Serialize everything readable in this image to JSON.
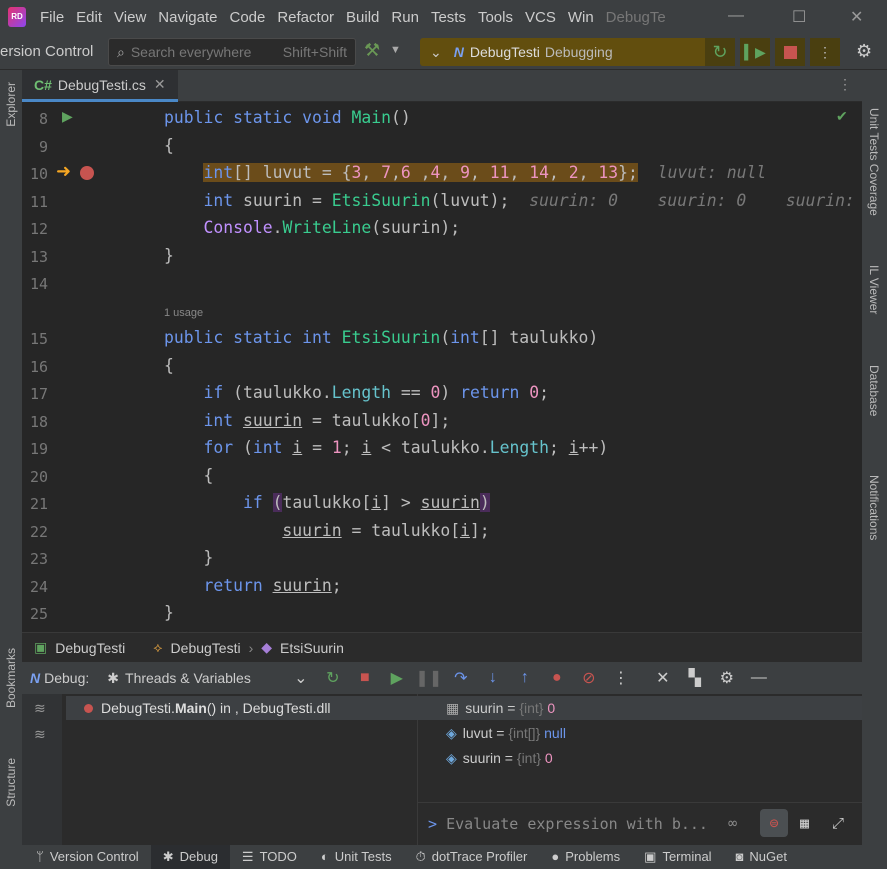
{
  "menu": [
    "File",
    "Edit",
    "View",
    "Navigate",
    "Code",
    "Refactor",
    "Build",
    "Run",
    "Tests",
    "Tools",
    "VCS",
    "Win"
  ],
  "window_title": "DebugTe",
  "toolbar": {
    "vcs_label": "ersion Control",
    "search_placeholder": "Search everywhere",
    "search_shortcut": "Shift+Shift",
    "run_config": "DebugTesti",
    "run_state": "Debugging"
  },
  "tab": {
    "lang": "C#",
    "label": "DebugTesti.cs"
  },
  "left_tools": [
    "Explorer",
    "Bookmarks",
    "Structure"
  ],
  "right_tools": [
    "Unit Tests Coverage",
    "IL Viewer",
    "Database",
    "Notifications"
  ],
  "editor": {
    "usage_hint": "1 usage",
    "lines": [
      {
        "n": "8",
        "t": [
          [
            "public static void ",
            "kw"
          ],
          [
            "Main",
            "fn"
          ],
          [
            "()",
            ""
          ]
        ]
      },
      {
        "n": "9",
        "t": [
          [
            "{",
            ""
          ]
        ]
      },
      {
        "n": "10",
        "hl": true,
        "t": [
          [
            "    ",
            ""
          ],
          [
            "int",
            "kw hl"
          ],
          [
            "[] luvut = {",
            "hl"
          ],
          [
            "3",
            "num hl"
          ],
          [
            ", ",
            "hl"
          ],
          [
            "7",
            "num hl"
          ],
          [
            ",",
            "hl"
          ],
          [
            "6",
            "num hl"
          ],
          [
            " ,",
            "hl"
          ],
          [
            "4",
            "num hl"
          ],
          [
            ", ",
            "hl"
          ],
          [
            "9",
            "num hl"
          ],
          [
            ", ",
            "hl"
          ],
          [
            "11",
            "num hl"
          ],
          [
            ", ",
            "hl"
          ],
          [
            "14",
            "num hl"
          ],
          [
            ", ",
            "hl"
          ],
          [
            "2",
            "num hl"
          ],
          [
            ", ",
            "hl"
          ],
          [
            "13",
            "num hl"
          ],
          [
            "};",
            "hl"
          ],
          [
            "  luvut: null",
            "hint"
          ]
        ]
      },
      {
        "n": "11",
        "t": [
          [
            "    ",
            ""
          ],
          [
            "int",
            "kw"
          ],
          [
            " suurin = ",
            ""
          ],
          [
            "EtsiSuurin",
            "fn"
          ],
          [
            "(luvut);",
            ""
          ],
          [
            "  suurin: 0    suurin: 0    suurin:",
            "hint"
          ]
        ]
      },
      {
        "n": "12",
        "t": [
          [
            "    ",
            ""
          ],
          [
            "Console",
            "cls"
          ],
          [
            ".",
            ""
          ],
          [
            "WriteLine",
            "fn"
          ],
          [
            "(suurin);",
            ""
          ]
        ]
      },
      {
        "n": "13",
        "t": [
          [
            "}",
            ""
          ]
        ]
      },
      {
        "n": "14",
        "t": []
      },
      {
        "n": "15",
        "t": [
          [
            "public static int ",
            "kw"
          ],
          [
            "EtsiSuurin",
            "fn"
          ],
          [
            "(",
            ""
          ],
          [
            "int",
            "kw"
          ],
          [
            "[] taulukko)",
            ""
          ]
        ]
      },
      {
        "n": "16",
        "t": [
          [
            "{",
            ""
          ]
        ]
      },
      {
        "n": "17",
        "t": [
          [
            "    ",
            ""
          ],
          [
            "if",
            "kw"
          ],
          [
            " (taulukko.",
            ""
          ],
          [
            "Length",
            "prop"
          ],
          [
            " == ",
            ""
          ],
          [
            "0",
            "num"
          ],
          [
            ") ",
            ""
          ],
          [
            "return ",
            "kw"
          ],
          [
            "0",
            "num"
          ],
          [
            ";",
            ""
          ]
        ]
      },
      {
        "n": "18",
        "t": [
          [
            "    ",
            ""
          ],
          [
            "int",
            "kw"
          ],
          [
            " ",
            ""
          ],
          [
            "suurin",
            "ul"
          ],
          [
            " = taulukko[",
            ""
          ],
          [
            "0",
            "num"
          ],
          [
            "];",
            ""
          ]
        ]
      },
      {
        "n": "19",
        "t": [
          [
            "    ",
            ""
          ],
          [
            "for",
            "kw"
          ],
          [
            " (",
            ""
          ],
          [
            "int",
            "kw"
          ],
          [
            " ",
            ""
          ],
          [
            "i",
            "ul"
          ],
          [
            " = ",
            ""
          ],
          [
            "1",
            "num"
          ],
          [
            "; ",
            ""
          ],
          [
            "i",
            "ul"
          ],
          [
            " < taulukko.",
            ""
          ],
          [
            "Length",
            "prop"
          ],
          [
            "; ",
            ""
          ],
          [
            "i",
            "ul"
          ],
          [
            "++)",
            ""
          ]
        ]
      },
      {
        "n": "20",
        "t": [
          [
            "    {",
            ""
          ]
        ]
      },
      {
        "n": "21",
        "t": [
          [
            "        ",
            ""
          ],
          [
            "if",
            "kw"
          ],
          [
            " ",
            ""
          ],
          [
            "(",
            "brk"
          ],
          [
            "taulukko[",
            ""
          ],
          [
            "i",
            "ul"
          ],
          [
            "] > ",
            ""
          ],
          [
            "suurin",
            "ul"
          ],
          [
            ")",
            "brk"
          ]
        ]
      },
      {
        "n": "22",
        "t": [
          [
            "            ",
            ""
          ],
          [
            "suurin",
            "ul"
          ],
          [
            " = taulukko[",
            ""
          ],
          [
            "i",
            "ul"
          ],
          [
            "];",
            ""
          ]
        ]
      },
      {
        "n": "23",
        "t": [
          [
            "    }",
            ""
          ]
        ]
      },
      {
        "n": "24",
        "t": [
          [
            "    ",
            ""
          ],
          [
            "return ",
            "kw"
          ],
          [
            "suurin",
            "ul"
          ],
          [
            ";",
            ""
          ]
        ]
      },
      {
        "n": "25",
        "t": [
          [
            "}",
            ""
          ]
        ]
      }
    ]
  },
  "breadcrumb": [
    "DebugTesti",
    "DebugTesti",
    "EtsiSuurin"
  ],
  "debug": {
    "label": "Debug:",
    "tab": "Threads & Variables"
  },
  "frame": {
    "ns": "DebugTesti.",
    "method": "Main",
    "rest": "() in , DebugTesti.dll"
  },
  "variables": [
    {
      "name": "suurin",
      "type": "{int}",
      "value": "0",
      "color": "#ed94c0"
    },
    {
      "name": "luvut",
      "type": "{int[]}",
      "value": "null",
      "color": "#6c95eb"
    },
    {
      "name": "suurin",
      "type": "{int}",
      "value": "0",
      "color": "#ed94c0"
    }
  ],
  "eval_placeholder": "Evaluate expression with b...",
  "status": [
    "Version Control",
    "Debug",
    "TODO",
    "Unit Tests",
    "dotTrace Profiler",
    "Problems",
    "Terminal",
    "NuGet"
  ]
}
